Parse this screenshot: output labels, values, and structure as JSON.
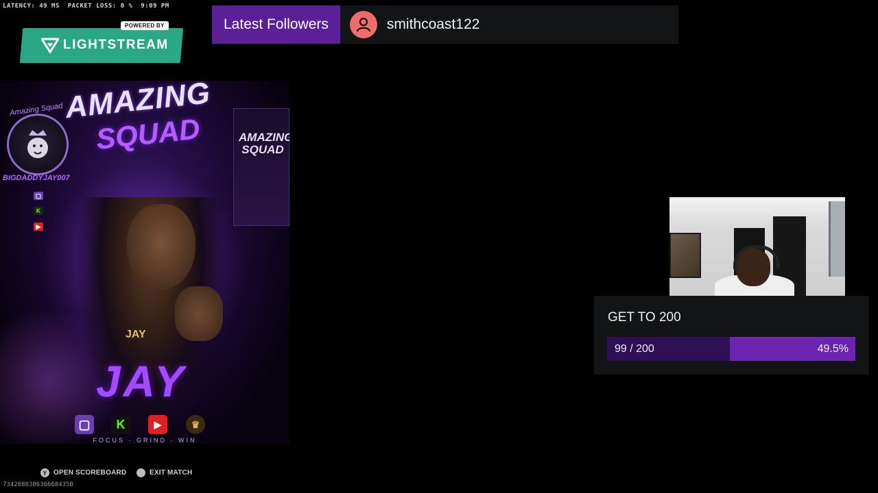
{
  "stats": {
    "text": "LATENCY: 49 MS  PACKET LOSS: 0 %  9:09 PM"
  },
  "branding": {
    "powered_by": "POWERED BY",
    "brand": "LIGHTSTREAM",
    "color": "#2aa886"
  },
  "followers": {
    "title": "Latest Followers",
    "latest": "smithcoast122",
    "avatar_icon": "user-icon",
    "accent": "#5b1f98"
  },
  "poster": {
    "title_line1": "AMAZING",
    "title_line2": "SQUAD",
    "crest_label": "Amazing Squad",
    "handle": "BIGDADDYJAY007",
    "banner_text": "AMAZING SQUAD",
    "chest_text": "JAY",
    "name": "JAY",
    "tagline": "FOCUS · GRIND · WIN",
    "social_icons": [
      "twitch-icon",
      "kick-icon",
      "youtube-icon",
      "lion-crest-icon"
    ]
  },
  "hints": {
    "scoreboard": {
      "button": "Y",
      "label": "OPEN SCOREBOARD"
    },
    "exit": {
      "button": "",
      "label": "EXIT MATCH"
    }
  },
  "session_id": "734288830636668435B",
  "goal": {
    "title": "GET TO 200",
    "count_text": "99 / 200",
    "percent_text": "49.5%",
    "progress": 0.495,
    "track_color": "#2f0f55",
    "fill_color": "#6a24ad"
  }
}
